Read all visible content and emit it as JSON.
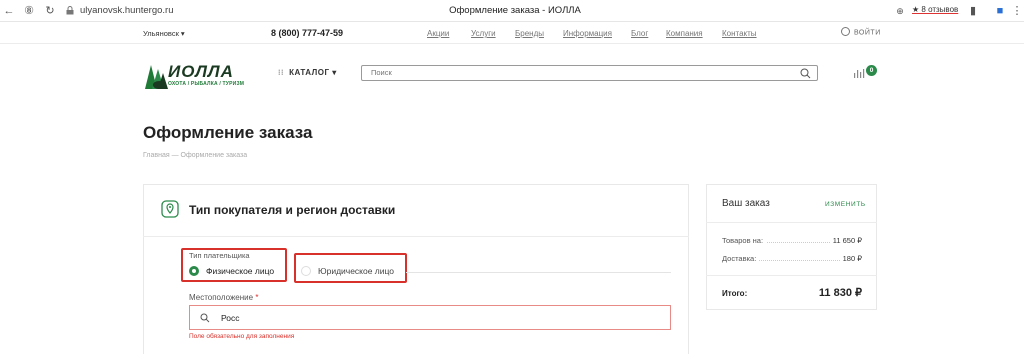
{
  "browser": {
    "url": "ulyanovsk.huntergo.ru",
    "tab_title": "Оформление заказа - ИОЛЛА",
    "reviews_ext": "★ 8 отзывов"
  },
  "topbar": {
    "city": "Ульяновск ▾",
    "phone": "8 (800) 777-47-59",
    "links": [
      "Акции",
      "Услуги",
      "Бренды",
      "Информация",
      "Блог",
      "Компания",
      "Контакты"
    ],
    "login": "ВОЙТИ"
  },
  "header": {
    "logo_text": "ИОЛЛА",
    "logo_sub": "ОХОТА / РЫБАЛКА / ТУРИЗМ",
    "catalog": "КАТАЛОГ ▾",
    "search_placeholder": "Поиск",
    "compare_count": "0"
  },
  "page": {
    "title": "Оформление заказа",
    "breadcrumb": "Главная — Оформление заказа"
  },
  "buyer_section": {
    "title": "Тип покупателя и регион доставки",
    "payer_label": "Тип плательщика",
    "option_individual": "Физическое лицо",
    "option_legal": "Юридическое лицо",
    "location_label": "Местоположение",
    "required_mark": "*",
    "location_value": "Росс",
    "location_error": "Поле обязательно для заполнения"
  },
  "order_summary": {
    "title": "Ваш заказ",
    "edit": "ИЗМЕНИТЬ",
    "items_label": "Товаров на:",
    "items_value": "11 650 ₽",
    "delivery_label": "Доставка:",
    "delivery_value": "180 ₽",
    "total_label": "Итого:",
    "total_value": "11 830 ₽"
  },
  "colors": {
    "accent": "#2b8a4a",
    "highlight": "#d8302a"
  }
}
